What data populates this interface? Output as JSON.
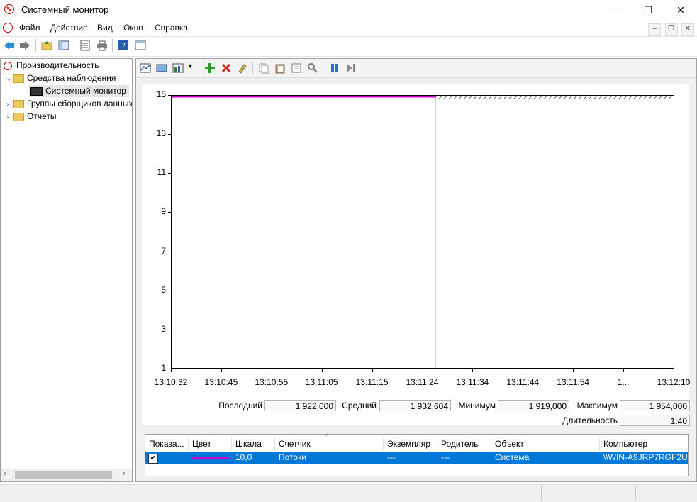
{
  "window": {
    "title": "Системный монитор",
    "minimize": "—",
    "maximize": "☐",
    "close": "✕"
  },
  "menu": [
    "Файл",
    "Действие",
    "Вид",
    "Окно",
    "Справка"
  ],
  "mdi": {
    "minimize": "–",
    "restore": "❐",
    "close": "✕"
  },
  "tree": {
    "root": "Производительность",
    "monitoring_tools": "Средства наблюдения",
    "system_monitor": "Системный монитор",
    "collector_sets": "Группы сборщиков данных",
    "reports": "Отчеты"
  },
  "chart_data": {
    "type": "line",
    "y_ticks": [
      "15",
      "13",
      "11",
      "9",
      "7",
      "5",
      "3",
      "1"
    ],
    "ylim": [
      1,
      15
    ],
    "x_ticks": [
      "13:10:32",
      "13:10:45",
      "13:10:55",
      "13:11:05",
      "13:11:15",
      "13:11:24",
      "13:11:34",
      "13:11:44",
      "13:11:54",
      "1...",
      "13:12:10"
    ],
    "series": [
      {
        "color": "#d000d0",
        "value": 15,
        "x_end_fraction": 0.525
      }
    ],
    "cursor_fraction": 0.525,
    "cursor_color": "#e00000"
  },
  "stats": {
    "last_label": "Последний",
    "last_value": "1 922,000",
    "avg_label": "Средний",
    "avg_value": "1 932,604",
    "min_label": "Минимум",
    "min_value": "1 919,000",
    "max_label": "Максимум",
    "max_value": "1 954,000",
    "duration_label": "Длительность",
    "duration_value": "1:40"
  },
  "counter_table": {
    "columns": [
      "Показа...",
      "Цвет",
      "Шкала",
      "Счетчик",
      "Экземпляр",
      "Родитель",
      "Объект",
      "Компьютер"
    ],
    "row": {
      "show_checked": "✔",
      "color": "#d000d0",
      "scale": "10,0",
      "counter": "Потоки",
      "instance": "---",
      "parent": "---",
      "object": "Система",
      "computer": "\\\\WIN-A9JRP7RGF2U"
    }
  },
  "colors": {
    "selection": "#0078d7",
    "accent_red": "#e00000"
  }
}
